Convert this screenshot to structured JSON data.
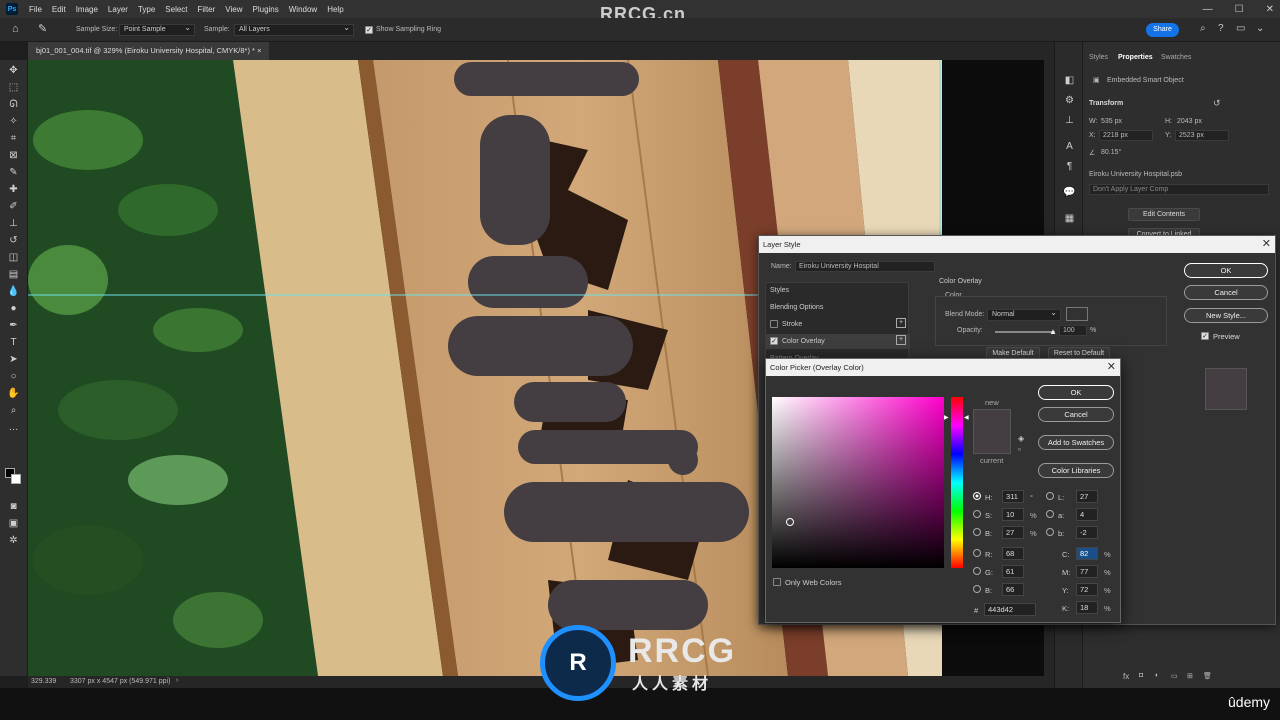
{
  "menu": [
    "File",
    "Edit",
    "Image",
    "Layer",
    "Type",
    "Select",
    "Filter",
    "View",
    "Plugins",
    "Window",
    "Help"
  ],
  "watermark": "RRCG.cn",
  "options": {
    "sample_size_label": "Sample Size:",
    "sample_size_value": "Point Sample",
    "sample_label": "Sample:",
    "sample_value": "All Layers",
    "show_ring_label": "Show Sampling Ring",
    "share_label": "Share"
  },
  "document": {
    "tab_title": "bj01_001_004.tif @ 329% (Eiroku University Hospital, CMYK/8*) *",
    "zoom_status": "329.339",
    "size_status": "3307 px x 4547 px (549.971 ppi)"
  },
  "panel": {
    "tabs": [
      "Styles",
      "Properties",
      "Swatches"
    ],
    "embedded": "Embedded Smart Object",
    "transform": "Transform",
    "w_label": "W:",
    "w_value": "535 px",
    "h_label": "H:",
    "h_value": "2043 px",
    "x_label": "X:",
    "x_value": "2218 px",
    "y_label": "Y:",
    "y_value": "2523 px",
    "angle": "80.15°",
    "psb": "Eiroku University Hospital.psb",
    "layer_comp": "Don't Apply Layer Comp",
    "edit_contents": "Edit Contents",
    "convert_linked": "Convert to Linked"
  },
  "layer_style": {
    "title": "Layer Style",
    "name_label": "Name:",
    "name_value": "Eiroku University Hospital",
    "styles_header": "Styles",
    "blending_options": "Blending Options",
    "stroke": "Stroke",
    "color_overlay": "Color Overlay",
    "pattern_overlay": "Pattern Overlay",
    "section_title": "Color Overlay",
    "section_sub": "Color",
    "blend_mode_label": "Blend Mode:",
    "blend_mode_value": "Normal",
    "opacity_label": "Opacity:",
    "opacity_value": "100",
    "opacity_unit": "%",
    "make_default": "Make Default",
    "reset_default": "Reset to Default",
    "ok": "OK",
    "cancel": "Cancel",
    "new_style": "New Style...",
    "preview": "Preview",
    "overlay_color": "#443d42"
  },
  "color_picker": {
    "title": "Color Picker (Overlay Color)",
    "ok": "OK",
    "cancel": "Cancel",
    "add_swatches": "Add to Swatches",
    "color_libraries": "Color Libraries",
    "new_label": "new",
    "current_label": "current",
    "only_web": "Only Web Colors",
    "H": "311",
    "S": "10",
    "B": "27",
    "R": "68",
    "G": "61",
    "Bv": "66",
    "L": "27",
    "a": "4",
    "b": "-2",
    "C": "82",
    "M": "77",
    "Y": "72",
    "K": "18",
    "hex": "443d42",
    "deg": "°",
    "pct": "%",
    "labels": {
      "H": "H:",
      "S": "S:",
      "B": "B:",
      "R": "R:",
      "G": "G:",
      "Bv": "B:",
      "L": "L:",
      "a": "a:",
      "b": "b:",
      "C": "C:",
      "M": "M:",
      "Y": "Y:",
      "K": "K:",
      "hash": "#"
    }
  },
  "brand": {
    "rrcg": "RRCG",
    "sub": "人人素材",
    "udemy": "ûdemy"
  }
}
